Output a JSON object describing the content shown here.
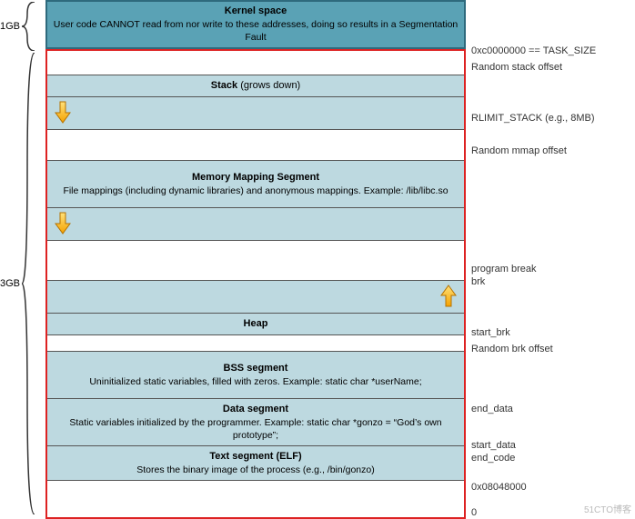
{
  "left": {
    "top_label": "1GB",
    "bottom_label": "3GB"
  },
  "kernel": {
    "title": "Kernel space",
    "desc": "User code CANNOT read from nor write to these addresses, doing so results in a Segmentation Fault"
  },
  "stack": {
    "title": "Stack",
    "suffix": " (grows down)"
  },
  "mmap": {
    "title": "Memory Mapping Segment",
    "desc": "File mappings (including dynamic libraries) and anonymous mappings. Example: /lib/libc.so"
  },
  "heap": {
    "title": "Heap"
  },
  "bss": {
    "title": "BSS segment",
    "desc": "Uninitialized static variables, filled with zeros. Example: static char *userName;"
  },
  "data": {
    "title": "Data segment",
    "desc": "Static variables initialized by the programmer. Example: static char *gonzo = “God’s own prototype”;"
  },
  "text": {
    "title": "Text segment (ELF)",
    "desc": "Stores the binary image of the process (e.g., /bin/gonzo)"
  },
  "right": {
    "task_size": "0xc0000000 == TASK_SIZE",
    "random_stack": "Random stack offset",
    "rlimit": "RLIMIT_STACK (e.g., 8MB)",
    "random_mmap": "Random mmap offset",
    "program_break": "program break",
    "brk": "brk",
    "start_brk": "start_brk",
    "random_brk": "Random brk offset",
    "end_data": "end_data",
    "start_data": "start_data",
    "end_code": "end_code",
    "text_addr": "0x08048000",
    "zero": "0"
  },
  "watermark": "51CTO博客"
}
